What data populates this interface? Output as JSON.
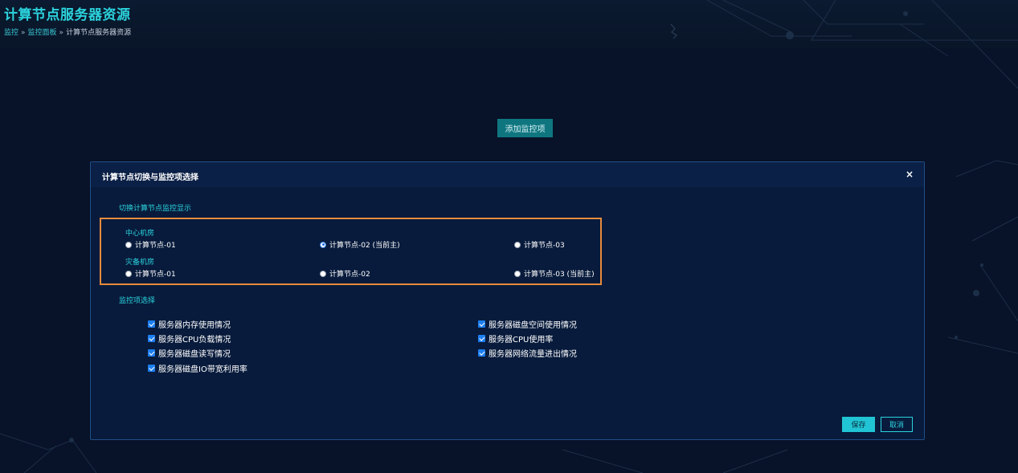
{
  "page": {
    "title": "计算节点服务器资源",
    "breadcrumb": [
      "监控",
      "监控面板",
      "计算节点服务器资源"
    ],
    "breadcrumb_separator": "»"
  },
  "toolbar": {
    "add_label": "添加监控项"
  },
  "modal": {
    "title": "计算节点切换与监控项选择",
    "close_symbol": "×",
    "node_section_label": "切换计算节点监控显示",
    "groups": [
      {
        "label": "中心机房",
        "options": [
          {
            "label": "计算节点-01",
            "checked": false
          },
          {
            "label": "计算节点-02 (当前主)",
            "checked": true
          },
          {
            "label": "计算节点-03",
            "checked": false
          }
        ]
      },
      {
        "label": "灾备机房",
        "options": [
          {
            "label": "计算节点-01",
            "checked": false
          },
          {
            "label": "计算节点-02",
            "checked": false
          },
          {
            "label": "计算节点-03 (当前主)",
            "checked": false
          }
        ]
      }
    ],
    "metrics_section_label": "监控项选择",
    "metrics_left": [
      {
        "label": "服务器内存使用情况",
        "checked": true
      },
      {
        "label": "服务器CPU负载情况",
        "checked": true
      },
      {
        "label": "服务器磁盘读写情况",
        "checked": true
      },
      {
        "label": "服务器磁盘IO带宽利用率",
        "checked": true
      }
    ],
    "metrics_right": [
      {
        "label": "服务器磁盘空间使用情况",
        "checked": true
      },
      {
        "label": "服务器CPU使用率",
        "checked": true
      },
      {
        "label": "服务器网络流量进出情况",
        "checked": true
      }
    ],
    "save_label": "保存",
    "cancel_label": "取消"
  },
  "colors": {
    "background": "#081228",
    "accent": "#2bd3dd",
    "highlight_border": "#e78b3c",
    "checkbox": "#1d7ef0",
    "add_button": "#0f7680"
  }
}
